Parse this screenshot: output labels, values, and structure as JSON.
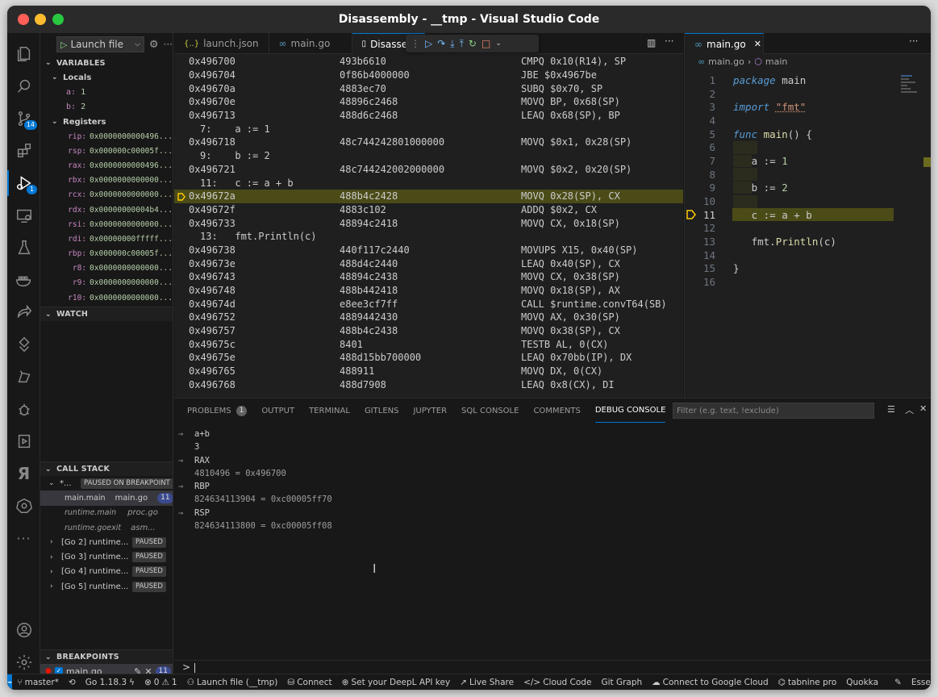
{
  "window": {
    "title": "Disassembly - __tmp - Visual Studio Code"
  },
  "activity": {
    "scm_badge": "14",
    "debug_badge": "1",
    "icons": [
      "explorer-icon",
      "search-icon",
      "source-control-icon",
      "extensions-icon",
      "run-debug-icon",
      "remote-explorer-icon",
      "testing-icon",
      "docker-icon",
      "live-share-icon",
      "git-graph-icon",
      "tabnine-icon",
      "debug-bug-icon",
      "run-icon",
      "yandex-icon",
      "kubernetes-icon",
      "more-icon",
      "account-icon",
      "settings-gear-icon"
    ],
    "yandex_glyph": "Я"
  },
  "debug_toolbar": {
    "config": "Launch file"
  },
  "variables": {
    "title": "VARIABLES",
    "locals_title": "Locals",
    "locals": [
      {
        "name": "a:",
        "value": "1"
      },
      {
        "name": "b:",
        "value": "2"
      }
    ],
    "registers_title": "Registers",
    "registers": [
      {
        "name": "rip:",
        "value": "0x0000000000496..."
      },
      {
        "name": "rsp:",
        "value": "0x000000c00005f..."
      },
      {
        "name": "rax:",
        "value": "0x0000000000496..."
      },
      {
        "name": "rbx:",
        "value": "0x0000000000000..."
      },
      {
        "name": "rcx:",
        "value": "0x0000000000000..."
      },
      {
        "name": "rdx:",
        "value": "0x00000000004b4..."
      },
      {
        "name": "rsi:",
        "value": "0x0000000000000..."
      },
      {
        "name": "rdi:",
        "value": "0x00000000fffff..."
      },
      {
        "name": "rbp:",
        "value": "0x000000c00005f..."
      },
      {
        "name": "r8:",
        "value": "0x0000000000000..."
      },
      {
        "name": "r9:",
        "value": "0x0000000000000..."
      },
      {
        "name": "r10:",
        "value": "0x0000000000000..."
      }
    ]
  },
  "watch": {
    "title": "WATCH"
  },
  "callstack": {
    "title": "CALL STACK",
    "thread": "*...",
    "thread_status": "PAUSED ON BREAKPOINT",
    "frames": [
      {
        "fn": "main.main",
        "file": "main.go",
        "line": "11"
      },
      {
        "fn": "runtime.main",
        "file": "proc.go"
      },
      {
        "fn": "runtime.goexit",
        "file": "asm..."
      }
    ],
    "goroutines": [
      {
        "name": "[Go 2] runtime....",
        "status": "PAUSED"
      },
      {
        "name": "[Go 3] runtime....",
        "status": "PAUSED"
      },
      {
        "name": "[Go 4] runtime....",
        "status": "PAUSED"
      },
      {
        "name": "[Go 5] runtime....",
        "status": "PAUSED"
      }
    ]
  },
  "breakpoints": {
    "title": "BREAKPOINTS",
    "file": "main.go",
    "count": "11"
  },
  "editor": {
    "tabs": [
      {
        "icon": "{..}",
        "label": "launch.json"
      },
      {
        "icon": "∞",
        "label": "main.go"
      },
      {
        "icon": "▯",
        "label": "Disassemb"
      }
    ],
    "disassembly": [
      {
        "addr": "0x496700",
        "bytes": "493b6610",
        "ins": "CMPQ 0x10(R14), SP"
      },
      {
        "addr": "0x496704",
        "bytes": "0f86b4000000",
        "ins": "JBE $0x4967be"
      },
      {
        "addr": "0x49670a",
        "bytes": "4883ec70",
        "ins": "SUBQ $0x70, SP"
      },
      {
        "addr": "0x49670e",
        "bytes": "48896c2468",
        "ins": "MOVQ BP, 0x68(SP)"
      },
      {
        "addr": "0x496713",
        "bytes": "488d6c2468",
        "ins": "LEAQ 0x68(SP), BP"
      },
      {
        "src": "7:    a := 1"
      },
      {
        "addr": "0x496718",
        "bytes": "48c744242801000000",
        "ins": "MOVQ $0x1, 0x28(SP)"
      },
      {
        "src": "9:    b := 2"
      },
      {
        "addr": "0x496721",
        "bytes": "48c744242002000000",
        "ins": "MOVQ $0x2, 0x20(SP)"
      },
      {
        "src": "11:   c := a + b"
      },
      {
        "addr": "0x49672a",
        "bytes": "488b4c2428",
        "ins": "MOVQ 0x28(SP), CX",
        "current": true
      },
      {
        "addr": "0x49672f",
        "bytes": "4883c102",
        "ins": "ADDQ $0x2, CX"
      },
      {
        "addr": "0x496733",
        "bytes": "48894c2418",
        "ins": "MOVQ CX, 0x18(SP)"
      },
      {
        "src": "13:   fmt.Println(c)"
      },
      {
        "addr": "0x496738",
        "bytes": "440f117c2440",
        "ins": "MOVUPS X15, 0x40(SP)"
      },
      {
        "addr": "0x49673e",
        "bytes": "488d4c2440",
        "ins": "LEAQ 0x40(SP), CX"
      },
      {
        "addr": "0x496743",
        "bytes": "48894c2438",
        "ins": "MOVQ CX, 0x38(SP)"
      },
      {
        "addr": "0x496748",
        "bytes": "488b442418",
        "ins": "MOVQ 0x18(SP), AX"
      },
      {
        "addr": "0x49674d",
        "bytes": "e8ee3cf7ff",
        "ins": "CALL $runtime.convT64(SB)"
      },
      {
        "addr": "0x496752",
        "bytes": "4889442430",
        "ins": "MOVQ AX, 0x30(SP)"
      },
      {
        "addr": "0x496757",
        "bytes": "488b4c2438",
        "ins": "MOVQ 0x38(SP), CX"
      },
      {
        "addr": "0x49675c",
        "bytes": "8401",
        "ins": "TESTB AL, 0(CX)"
      },
      {
        "addr": "0x49675e",
        "bytes": "488d15bb700000",
        "ins": "LEAQ 0x70bb(IP), DX"
      },
      {
        "addr": "0x496765",
        "bytes": "488911",
        "ins": "MOVQ DX, 0(CX)"
      },
      {
        "addr": "0x496768",
        "bytes": "488d7908",
        "ins": "LEAQ 0x8(CX), DI"
      }
    ]
  },
  "right_editor": {
    "tab": "main.go",
    "breadcrumb_file": "main.go",
    "breadcrumb_symbol": "main",
    "lines": [
      "1",
      "2",
      "3",
      "4",
      "5",
      "6",
      "7",
      "8",
      "9",
      "10",
      "11",
      "12",
      "13",
      "14",
      "15",
      "16"
    ],
    "code": {
      "l1_kw": "package",
      "l1_rest": " main",
      "l3_kw": "import",
      "l3_str": "\"fmt\"",
      "l5_kw": "func",
      "l5_fn": "main",
      "l5_rest": "() {",
      "l7_var": "a",
      "l7_op": " := ",
      "l7_num": "1",
      "l9_var": "b",
      "l9_op": " := ",
      "l9_num": "2",
      "l11": "c := a + b",
      "l13_pkg": "fmt.",
      "l13_fn": "Println",
      "l13_rest": "(c)",
      "l15": "}"
    }
  },
  "panel": {
    "tabs": [
      "PROBLEMS",
      "OUTPUT",
      "TERMINAL",
      "GITLENS",
      "JUPYTER",
      "SQL CONSOLE",
      "COMMENTS",
      "DEBUG CONSOLE"
    ],
    "problems_badge": "1",
    "filter_placeholder": "Filter (e.g. text, !exclude)",
    "console": [
      {
        "in": "a+b",
        "out": "3"
      },
      {
        "in": "RAX",
        "out": "4810496 = 0x496700"
      },
      {
        "in": "RBP",
        "out": "824634113904 = 0xc00005ff70"
      },
      {
        "in": "RSP",
        "out": "824634113800 = 0xc00005ff08"
      }
    ],
    "prompt": ">"
  },
  "status": {
    "branch": "master*",
    "go": "Go 1.18.3",
    "errors": "0",
    "warnings": "1",
    "launch": "Launch file (__tmp)",
    "connect": "Connect",
    "deepl": "Set your DeepL API key",
    "liveshare": "Live Share",
    "cloudcode": "Cloud Code",
    "gitgraph": "Git Graph",
    "gcloud": "Connect to Google Cloud",
    "tabnine": "tabnine pro",
    "quokka": "Quokka",
    "user": "Essex"
  }
}
